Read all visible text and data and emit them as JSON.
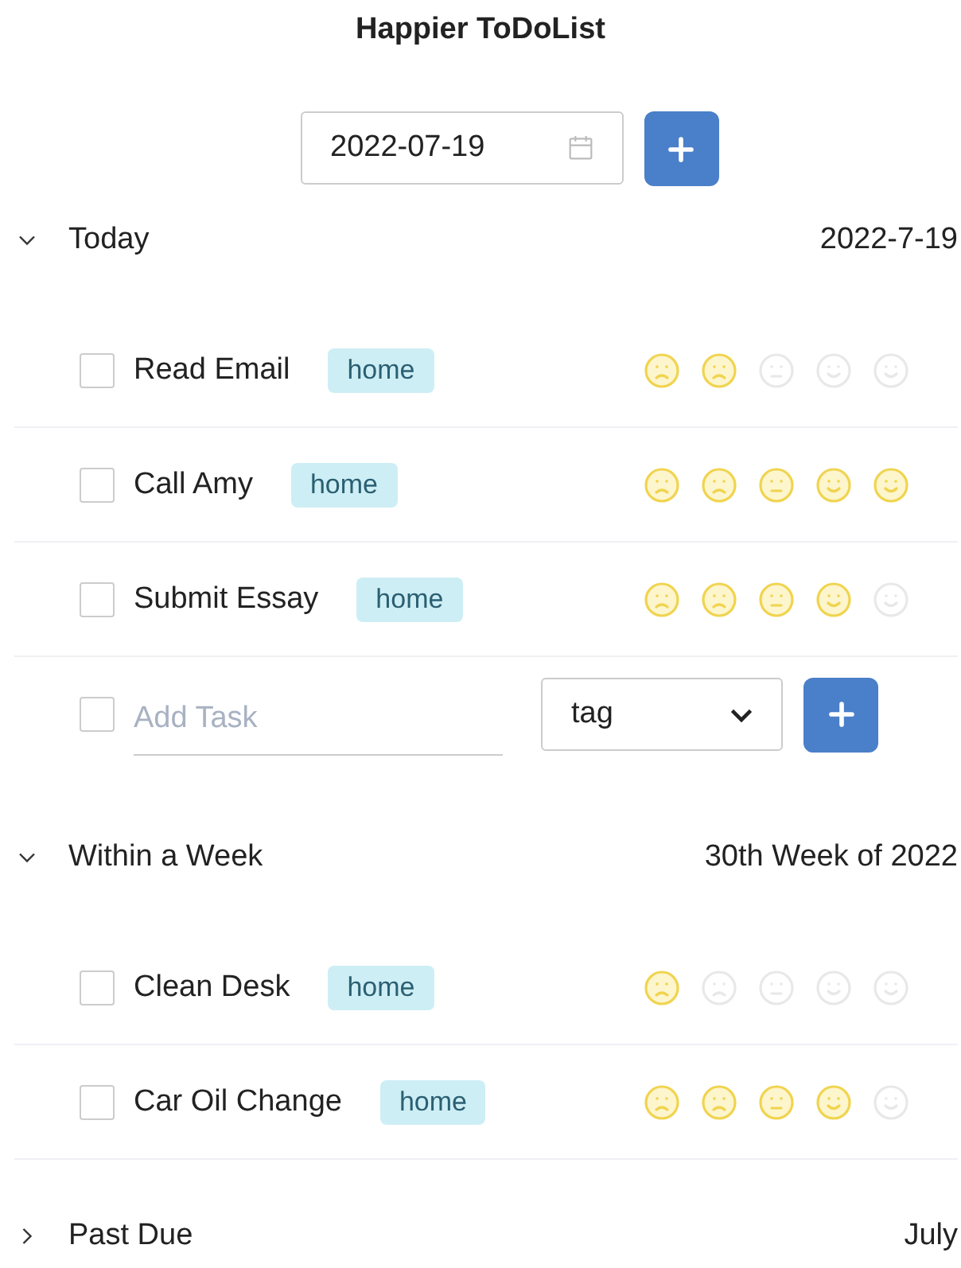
{
  "title": "Happier ToDoList",
  "date_picker": {
    "value": "2022-07-19"
  },
  "sections": [
    {
      "label": "Today",
      "date": "2022-7-19",
      "expanded": true,
      "tasks": [
        {
          "text": "Read Email",
          "tag": "home",
          "checked": false,
          "stars": 2
        },
        {
          "text": "Call Amy",
          "tag": "home",
          "checked": false,
          "stars": 5
        },
        {
          "text": "Submit Essay",
          "tag": "home",
          "checked": false,
          "stars": 4
        }
      ],
      "add_task": {
        "checked": false,
        "placeholder": "Add Task",
        "tag_select": "tag"
      }
    },
    {
      "label": "Within a Week",
      "date": "30th Week of 2022",
      "expanded": true,
      "tasks": [
        {
          "text": "Clean Desk",
          "tag": "home",
          "checked": false,
          "stars": 1
        },
        {
          "text": "Car Oil Change",
          "tag": "home",
          "checked": false,
          "stars": 4
        }
      ]
    },
    {
      "label": "Past Due",
      "date": "July",
      "expanded": false
    }
  ]
}
